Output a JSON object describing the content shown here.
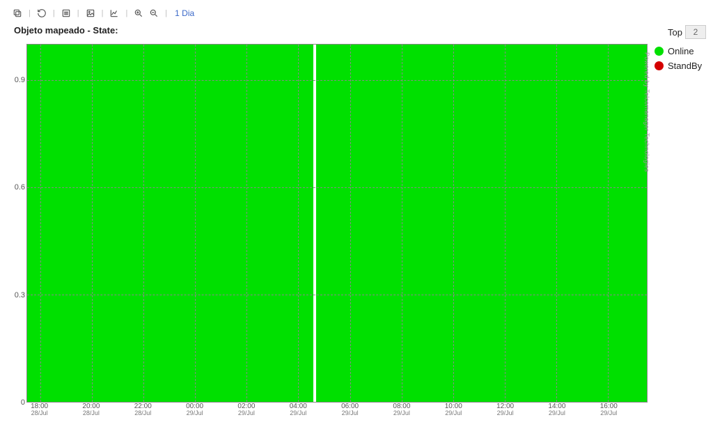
{
  "toolbar": {
    "period_label": "1 Dia"
  },
  "top_control": {
    "label": "Top",
    "value": "2"
  },
  "legend": {
    "items": [
      {
        "label": "Online",
        "color": "#00e000"
      },
      {
        "label": "StandBy",
        "color": "#d40000"
      }
    ]
  },
  "watermark": "Powered by Telcomanager Technologies",
  "chart_data": {
    "type": "area",
    "title": "Objeto mapeado - State:",
    "xlabel": "",
    "ylabel": "",
    "ylim": [
      0,
      1
    ],
    "y_ticks": [
      0,
      0.3,
      0.6,
      0.9
    ],
    "x_ticks": [
      {
        "time": "18:00",
        "date": "28/Jul"
      },
      {
        "time": "20:00",
        "date": "28/Jul"
      },
      {
        "time": "22:00",
        "date": "28/Jul"
      },
      {
        "time": "00:00",
        "date": "29/Jul"
      },
      {
        "time": "02:00",
        "date": "29/Jul"
      },
      {
        "time": "04:00",
        "date": "29/Jul"
      },
      {
        "time": "06:00",
        "date": "29/Jul"
      },
      {
        "time": "08:00",
        "date": "29/Jul"
      },
      {
        "time": "10:00",
        "date": "29/Jul"
      },
      {
        "time": "12:00",
        "date": "29/Jul"
      },
      {
        "time": "14:00",
        "date": "29/Jul"
      },
      {
        "time": "16:00",
        "date": "29/Jul"
      }
    ],
    "x_range_hours": 24,
    "x_start_hour_offset": 0.5,
    "series": [
      {
        "name": "Online",
        "color": "#00e000",
        "segments": [
          {
            "from_hr": 0.0,
            "to_hr": 11.08,
            "value": 1.0
          },
          {
            "from_hr": 11.18,
            "to_hr": 24.0,
            "value": 1.0
          }
        ]
      },
      {
        "name": "StandBy",
        "color": "#d40000",
        "segments": []
      }
    ]
  }
}
